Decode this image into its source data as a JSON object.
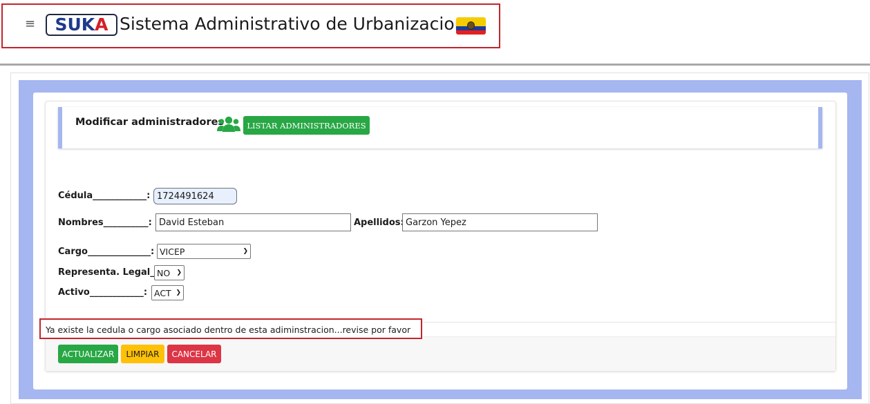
{
  "header": {
    "menu_icon": "≡",
    "logo": {
      "part1": "SUK",
      "part2": "A"
    },
    "title": "Sistema Administrativo de Urbanizaciones"
  },
  "section": {
    "title": "Modificar administradores",
    "icon": "users-icon",
    "list_button": "LISTAR ADMINISTRADORES"
  },
  "form": {
    "cedula": {
      "label": "Cédula____________:",
      "value": "1724491624"
    },
    "nombres": {
      "label": "Nombres__________:",
      "value": "David Esteban"
    },
    "apellidos": {
      "label": "Apellidos:",
      "value": "Garzon Yepez"
    },
    "cargo": {
      "label": "Cargo______________:",
      "value": "VICEP"
    },
    "representa_legal": {
      "label": "Representa. Legal__:",
      "value": "NO"
    },
    "activo": {
      "label": "Activo____________:",
      "value": "ACT"
    }
  },
  "message": "Ya existe la cedula o cargo asociado dentro de esta adiminstracion...revise por favor",
  "buttons": {
    "update": "ACTUALIZAR",
    "clear": "LIMPIAR",
    "cancel": "CANCELAR"
  },
  "colors": {
    "accent_green": "#28a745",
    "warning_yellow": "#ffc107",
    "danger_red": "#dc3545",
    "panel_blue": "#a5b6f0",
    "highlight_border": "#c3242c"
  }
}
